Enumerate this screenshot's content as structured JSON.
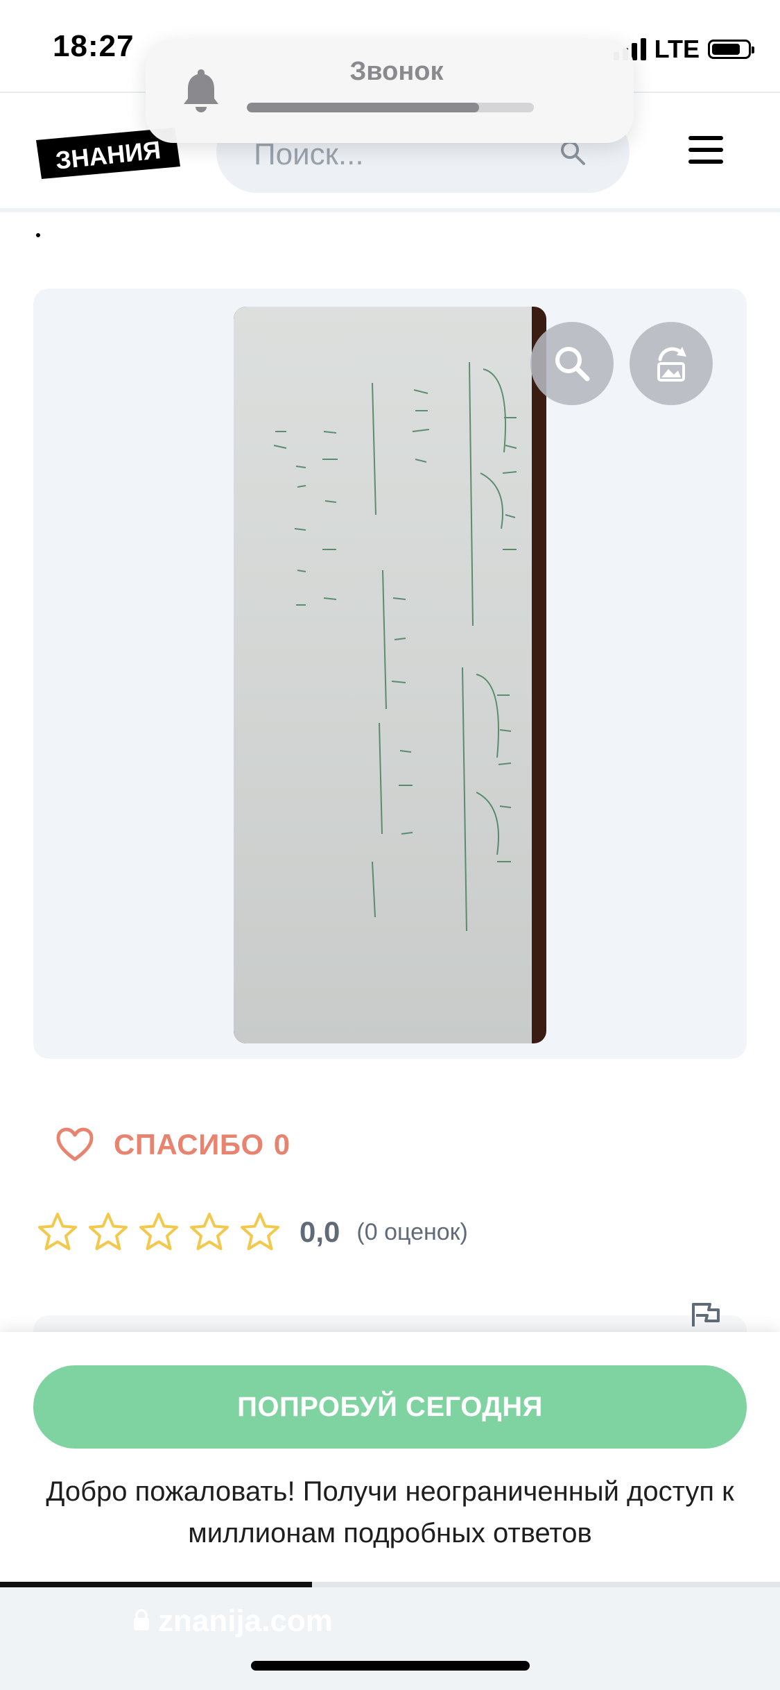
{
  "status_bar": {
    "time": "18:27",
    "network": "LTE",
    "battery_level": 0.8
  },
  "notification": {
    "title": "Звонок",
    "progress": 0.81
  },
  "header": {
    "logo_text": "ЗНАНИЯ",
    "search_placeholder": "Поиск..."
  },
  "answer": {
    "thanks_label": "СПАСИБО",
    "thanks_count": "0",
    "rating_value": "0,0",
    "rating_count": "(0 оценок)",
    "stars_total": 5,
    "stars_filled": 0
  },
  "bottom_sheet": {
    "cta_label": "ПОПРОБУЙ СЕГОДНЯ",
    "welcome_text": "Добро пожаловать! Получи неограниченный доступ к миллионам подробных ответов"
  },
  "page_progress": 0.4,
  "browser": {
    "url": "znanija.com"
  },
  "colors": {
    "accent_green": "#7fd3a0",
    "thanks_red": "#e8836f",
    "star_yellow": "#f2c94c",
    "logo_black": "#000000"
  }
}
